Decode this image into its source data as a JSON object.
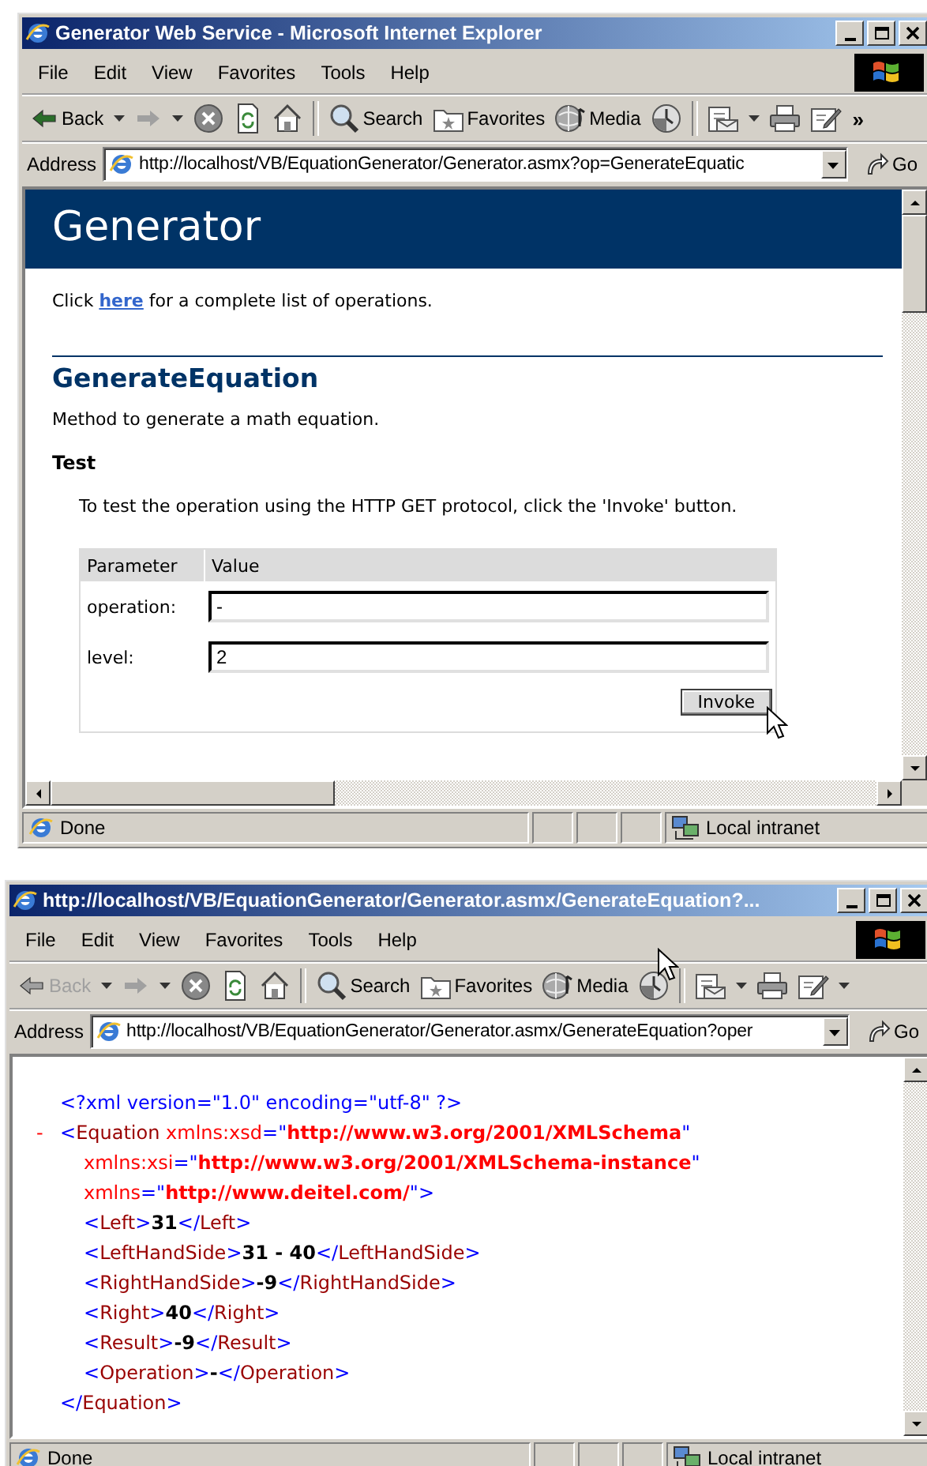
{
  "windows": [
    {
      "title": "Generator Web Service - Microsoft Internet Explorer",
      "menu": [
        "File",
        "Edit",
        "View",
        "Favorites",
        "Tools",
        "Help"
      ],
      "toolbar": [
        {
          "kind": "back",
          "label": "Back",
          "disabled": false
        },
        {
          "kind": "caret"
        },
        {
          "kind": "forward",
          "disabled": true
        },
        {
          "kind": "caret"
        },
        {
          "kind": "stop"
        },
        {
          "kind": "refresh"
        },
        {
          "kind": "home"
        },
        {
          "kind": "separator"
        },
        {
          "kind": "search",
          "label": "Search"
        },
        {
          "kind": "favorites",
          "label": "Favorites"
        },
        {
          "kind": "media",
          "label": "Media"
        },
        {
          "kind": "history"
        },
        {
          "kind": "separator"
        },
        {
          "kind": "mail"
        },
        {
          "kind": "caret"
        },
        {
          "kind": "print"
        },
        {
          "kind": "edit"
        },
        {
          "kind": "overflow",
          "label": "»"
        }
      ],
      "address": {
        "label": "Address",
        "url": "http://localhost/VB/EquationGenerator/Generator.asmx?op=GenerateEquatic"
      },
      "go": "Go",
      "content": {
        "kind": "page",
        "header": "Generator",
        "intro": {
          "before": "Click ",
          "link": "here",
          "after": " for a complete list of operations."
        },
        "method": {
          "name": "GenerateEquation",
          "description": "Method to generate a math equation."
        },
        "test": {
          "heading": "Test",
          "instructions": "To test the operation using the HTTP GET protocol, click the 'Invoke' button.",
          "columns": [
            "Parameter",
            "Value"
          ],
          "parameters": [
            {
              "label": "operation:",
              "value": "-"
            },
            {
              "label": "level:",
              "value": "2"
            }
          ],
          "button": "Invoke"
        }
      },
      "status": {
        "text": "Done",
        "zone": "Local intranet"
      }
    },
    {
      "title": "http://localhost/VB/EquationGenerator/Generator.asmx/GenerateEquation?...",
      "menu": [
        "File",
        "Edit",
        "View",
        "Favorites",
        "Tools",
        "Help"
      ],
      "toolbar": [
        {
          "kind": "back",
          "label": "Back",
          "disabled": true
        },
        {
          "kind": "caret"
        },
        {
          "kind": "forward",
          "disabled": true
        },
        {
          "kind": "caret"
        },
        {
          "kind": "stop"
        },
        {
          "kind": "refresh"
        },
        {
          "kind": "home"
        },
        {
          "kind": "separator"
        },
        {
          "kind": "search",
          "label": "Search"
        },
        {
          "kind": "favorites",
          "label": "Favorites"
        },
        {
          "kind": "media",
          "label": "Media"
        },
        {
          "kind": "history"
        },
        {
          "kind": "separator"
        },
        {
          "kind": "mail"
        },
        {
          "kind": "caret"
        },
        {
          "kind": "print"
        },
        {
          "kind": "edit"
        },
        {
          "kind": "caret"
        }
      ],
      "address": {
        "label": "Address",
        "url": "http://localhost/VB/EquationGenerator/Generator.asmx/GenerateEquation?oper"
      },
      "go": "Go",
      "content": {
        "kind": "xml",
        "declaration": [
          {
            "kind": "punct",
            "text": "<?xml version=\"1.0\" encoding=\"utf-8\" ?>"
          }
        ],
        "root": {
          "toggle": "-",
          "open": [
            [
              {
                "kind": "punct",
                "text": "<"
              },
              {
                "kind": "tag",
                "text": "Equation"
              },
              {
                "kind": "attr",
                "text": " xmlns:xsd"
              },
              {
                "kind": "punct",
                "text": "=\""
              },
              {
                "kind": "value",
                "text": "http://www.w3.org/2001/XMLSchema"
              },
              {
                "kind": "punct",
                "text": "\""
              }
            ],
            [
              {
                "kind": "attr",
                "text": "xmlns:xsi"
              },
              {
                "kind": "punct",
                "text": "=\""
              },
              {
                "kind": "value",
                "text": "http://www.w3.org/2001/XMLSchema-instance"
              },
              {
                "kind": "punct",
                "text": "\""
              }
            ],
            [
              {
                "kind": "attr",
                "text": "xmlns"
              },
              {
                "kind": "punct",
                "text": "=\""
              },
              {
                "kind": "value",
                "text": "http://www.deitel.com/"
              },
              {
                "kind": "punct",
                "text": "\">"
              }
            ]
          ],
          "children": [
            [
              {
                "kind": "punct",
                "text": "<"
              },
              {
                "kind": "tag",
                "text": "Left"
              },
              {
                "kind": "punct",
                "text": ">"
              },
              {
                "kind": "text",
                "text": "31"
              },
              {
                "kind": "punct",
                "text": "</"
              },
              {
                "kind": "tag",
                "text": "Left"
              },
              {
                "kind": "punct",
                "text": ">"
              }
            ],
            [
              {
                "kind": "punct",
                "text": "<"
              },
              {
                "kind": "tag",
                "text": "LeftHandSide"
              },
              {
                "kind": "punct",
                "text": ">"
              },
              {
                "kind": "text",
                "text": "31 - 40"
              },
              {
                "kind": "punct",
                "text": "</"
              },
              {
                "kind": "tag",
                "text": "LeftHandSide"
              },
              {
                "kind": "punct",
                "text": ">"
              }
            ],
            [
              {
                "kind": "punct",
                "text": "<"
              },
              {
                "kind": "tag",
                "text": "RightHandSide"
              },
              {
                "kind": "punct",
                "text": ">"
              },
              {
                "kind": "text",
                "text": "-9"
              },
              {
                "kind": "punct",
                "text": "</"
              },
              {
                "kind": "tag",
                "text": "RightHandSide"
              },
              {
                "kind": "punct",
                "text": ">"
              }
            ],
            [
              {
                "kind": "punct",
                "text": "<"
              },
              {
                "kind": "tag",
                "text": "Right"
              },
              {
                "kind": "punct",
                "text": ">"
              },
              {
                "kind": "text",
                "text": "40"
              },
              {
                "kind": "punct",
                "text": "</"
              },
              {
                "kind": "tag",
                "text": "Right"
              },
              {
                "kind": "punct",
                "text": ">"
              }
            ],
            [
              {
                "kind": "punct",
                "text": "<"
              },
              {
                "kind": "tag",
                "text": "Result"
              },
              {
                "kind": "punct",
                "text": ">"
              },
              {
                "kind": "text",
                "text": "-9"
              },
              {
                "kind": "punct",
                "text": "</"
              },
              {
                "kind": "tag",
                "text": "Result"
              },
              {
                "kind": "punct",
                "text": ">"
              }
            ],
            [
              {
                "kind": "punct",
                "text": "<"
              },
              {
                "kind": "tag",
                "text": "Operation"
              },
              {
                "kind": "punct",
                "text": ">"
              },
              {
                "kind": "text",
                "text": "-"
              },
              {
                "kind": "punct",
                "text": "</"
              },
              {
                "kind": "tag",
                "text": "Operation"
              },
              {
                "kind": "punct",
                "text": ">"
              }
            ]
          ],
          "close": [
            {
              "kind": "punct",
              "text": "</"
            },
            {
              "kind": "tag",
              "text": "Equation"
            },
            {
              "kind": "punct",
              "text": ">"
            }
          ]
        }
      },
      "status": {
        "text": "Done",
        "zone": "Local intranet"
      }
    }
  ]
}
